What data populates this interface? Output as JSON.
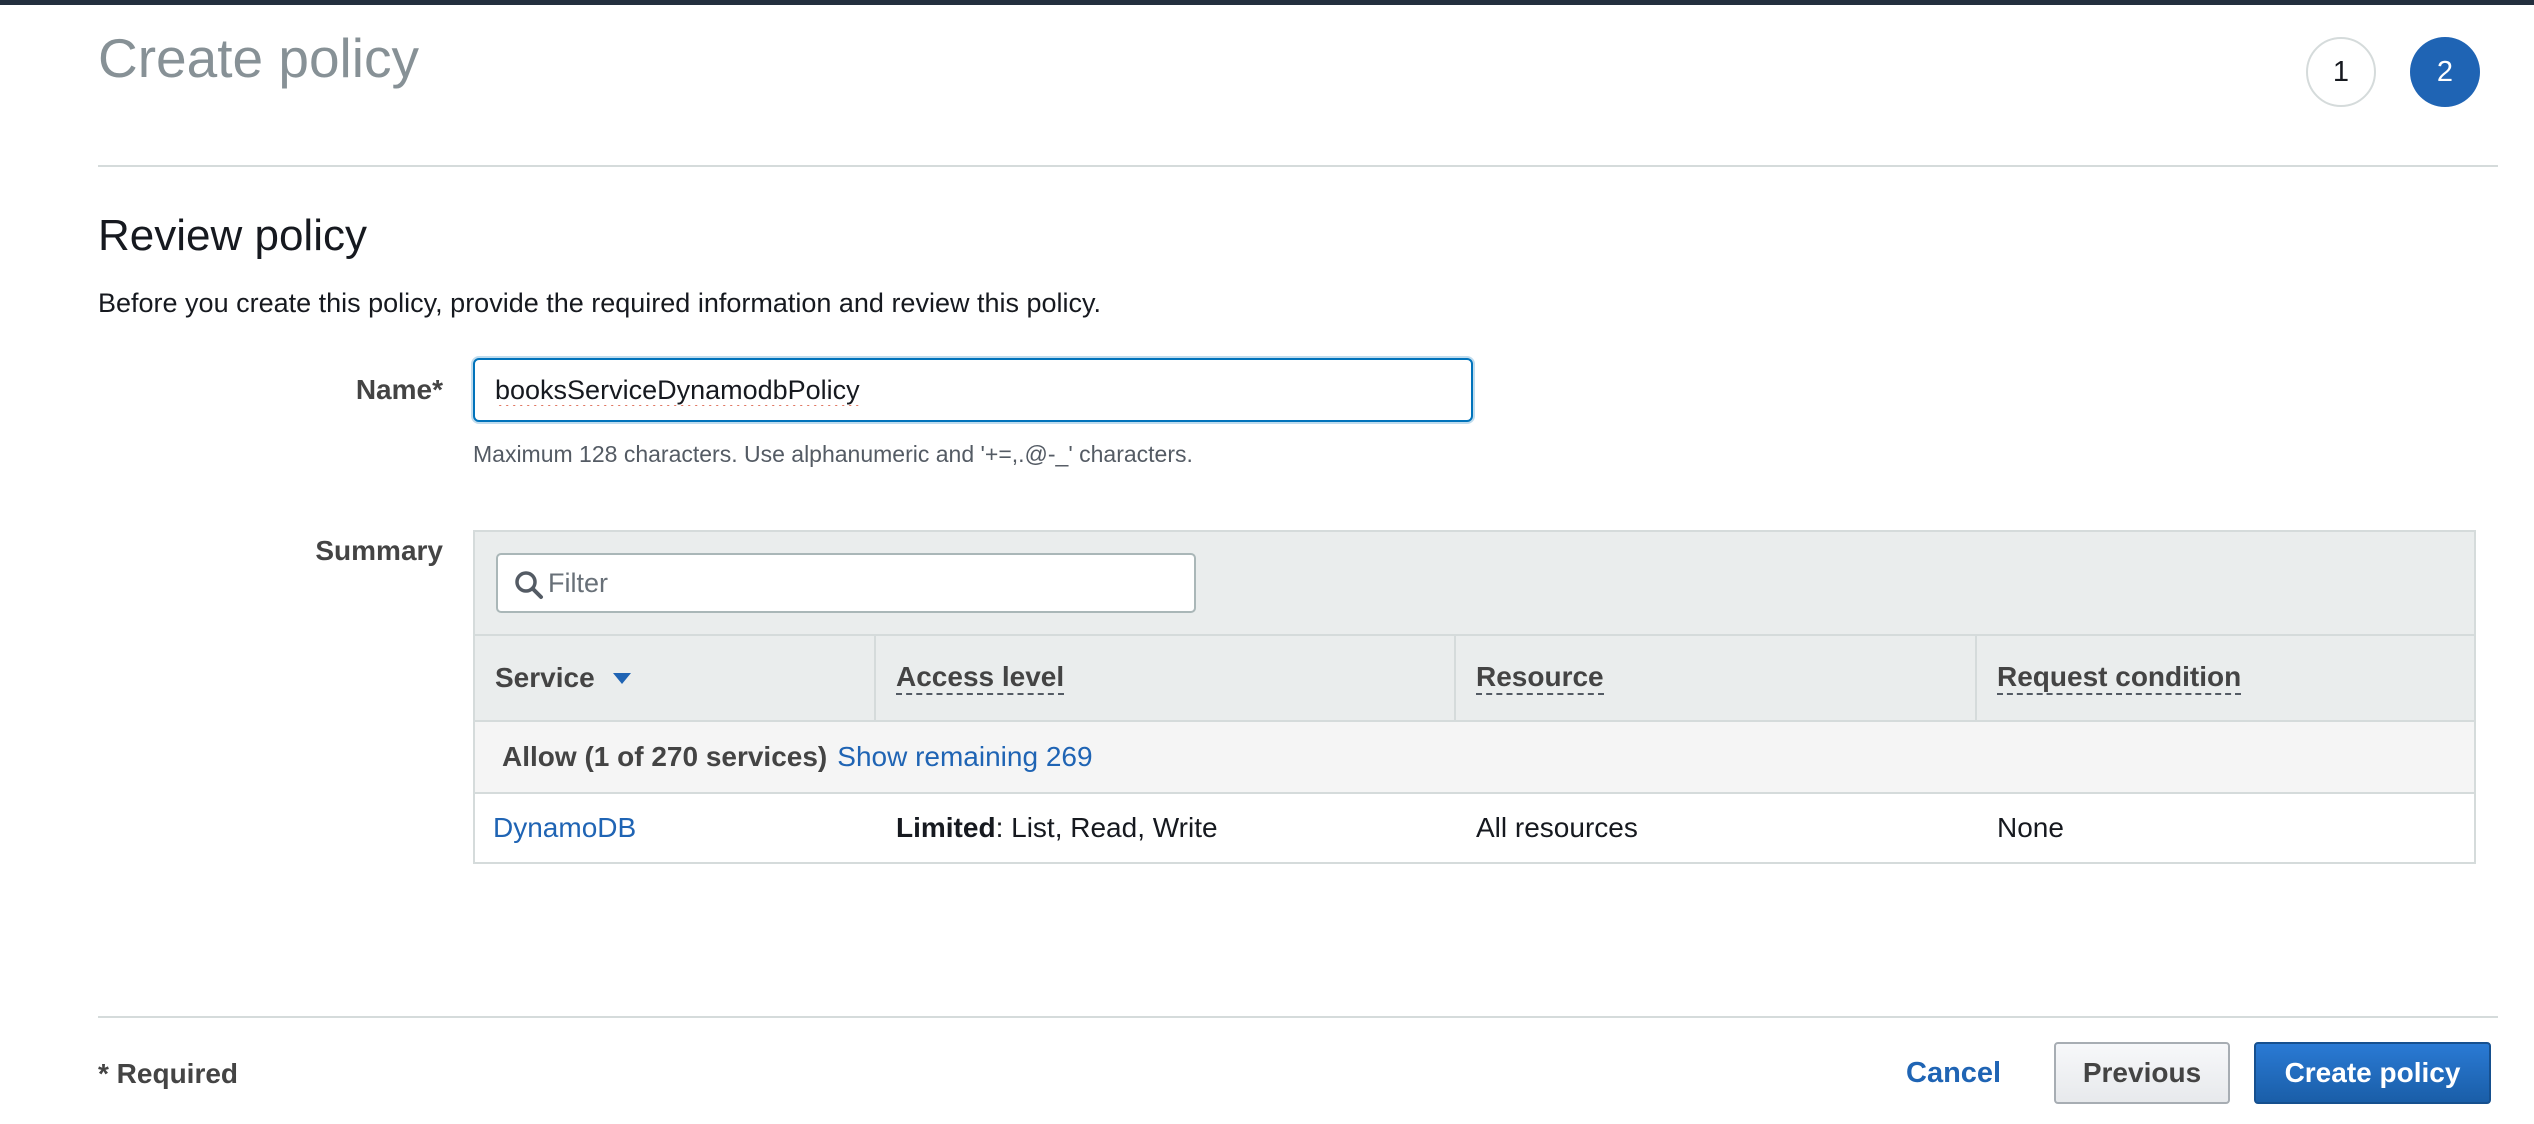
{
  "header": {
    "title": "Create policy",
    "steps": [
      "1",
      "2"
    ],
    "active_step": "2"
  },
  "review": {
    "title": "Review policy",
    "description": "Before you create this policy, provide the required information and review this policy."
  },
  "name_field": {
    "label": "Name*",
    "value": "booksServiceDynamodbPolicy",
    "hint": "Maximum 128 characters. Use alphanumeric and '+=,.@-_' characters."
  },
  "summary": {
    "label": "Summary",
    "filter_placeholder": "Filter",
    "columns": [
      "Service",
      "Access level",
      "Resource",
      "Request condition"
    ],
    "group": {
      "label": "Allow (1 of 270 services)",
      "link": "Show remaining 269"
    },
    "rows": [
      {
        "service": "DynamoDB",
        "access_strong": "Limited",
        "access_rest": ": List, Read, Write",
        "resource": "All resources",
        "condition": "None"
      }
    ]
  },
  "footer": {
    "required_note": "* Required",
    "cancel_label": "Cancel",
    "previous_label": "Previous",
    "create_label": "Create policy"
  },
  "colors": {
    "accent": "#1f64b4",
    "topbar": "#232f3e",
    "table_header_bg": "#eaeded"
  }
}
